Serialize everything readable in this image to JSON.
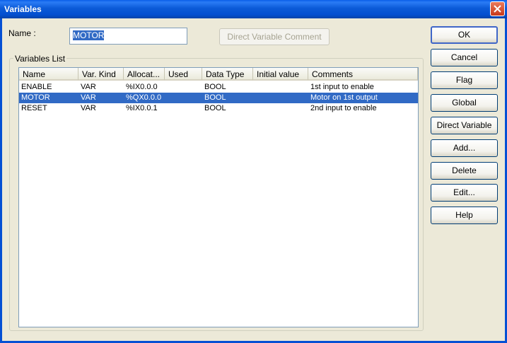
{
  "window": {
    "title": "Variables"
  },
  "name_field": {
    "label": "Name :",
    "value": "MOTOR"
  },
  "direct_comment_button": "Direct Variable Comment",
  "group_label": "Variables List",
  "columns": [
    "Name",
    "Var. Kind",
    "Allocat...",
    "Used",
    "Data Type",
    "Initial value",
    "Comments"
  ],
  "rows": [
    [
      "ENABLE",
      "VAR",
      "%IX0.0.0",
      "",
      "BOOL",
      "",
      "1st input to enable"
    ],
    [
      "MOTOR",
      "VAR",
      "%QX0.0.0",
      "",
      "BOOL",
      "",
      "Motor on 1st output"
    ],
    [
      "RESET",
      "VAR",
      "%IX0.0.1",
      "",
      "BOOL",
      "",
      "2nd input to enable"
    ]
  ],
  "selected_row": 1,
  "buttons": {
    "ok": "OK",
    "cancel": "Cancel",
    "flag": "Flag",
    "global": "Global",
    "direct_variable": "Direct Variable",
    "add": "Add...",
    "delete": "Delete",
    "edit": "Edit...",
    "help": "Help"
  },
  "colors": {
    "selection": "#316ac5",
    "titlebar": "#0a5ee8"
  }
}
